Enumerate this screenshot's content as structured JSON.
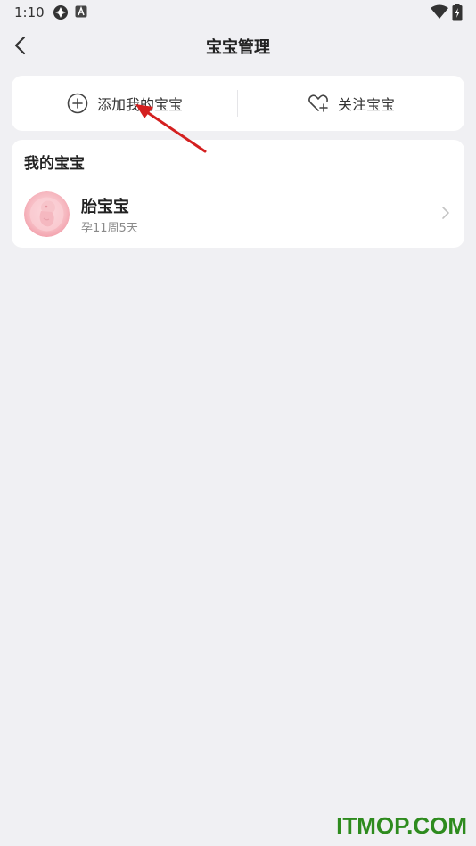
{
  "status_bar": {
    "time": "1:10"
  },
  "header": {
    "title": "宝宝管理"
  },
  "actions": {
    "add_label": "添加我的宝宝",
    "follow_label": "关注宝宝"
  },
  "my_babies": {
    "section_title": "我的宝宝",
    "items": [
      {
        "name": "胎宝宝",
        "status": "孕11周5天"
      }
    ]
  },
  "watermark": {
    "text": "ITMOP.COM"
  },
  "colors": {
    "background": "#f0f0f3",
    "card": "#ffffff",
    "annotation_arrow": "#d42020",
    "watermark": "#2e8b1e"
  },
  "icons": {
    "back": "back-arrow-icon",
    "add": "plus-circle-icon",
    "follow": "heart-plus-icon",
    "chevron": "chevron-right-icon"
  }
}
